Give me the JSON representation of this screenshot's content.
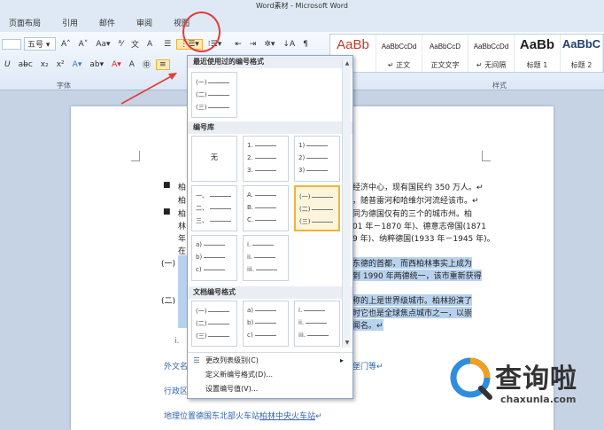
{
  "window": {
    "title": "Word素材 - Microsoft Word"
  },
  "tabs": [
    "页面布局",
    "引用",
    "邮件",
    "审阅",
    "视图"
  ],
  "ribbon": {
    "font_size": "五号",
    "font_group_label": "字体",
    "styles_group_label": "样式",
    "styles": [
      {
        "preview": "AaBb",
        "label": ""
      },
      {
        "preview": "AaBbCcDd",
        "label": "↵ 正文"
      },
      {
        "preview": "AaBbCcD",
        "label": "正文文字"
      },
      {
        "preview": "AaBbCcDd",
        "label": "↵ 无间隔"
      },
      {
        "preview": "AaBb",
        "label": "标题 1"
      },
      {
        "preview": "AaBbC",
        "label": "标题 2"
      }
    ]
  },
  "dropdown": {
    "recent_header": "最近使用过的编号格式",
    "library_header": "编号库",
    "doc_header": "文档编号格式",
    "none_label": "无",
    "recent": [
      [
        "(一)",
        "(二)",
        "(三)"
      ]
    ],
    "library": [
      [
        "1.",
        "2.",
        "3."
      ],
      [
        "1)",
        "2)",
        "3)"
      ],
      [
        "一、",
        "二、",
        "三、"
      ],
      [
        "A.",
        "B.",
        "C."
      ],
      [
        "(一)",
        "(二)",
        "(三)"
      ],
      [
        "a)",
        "b)",
        "c)"
      ],
      [
        "i.",
        "ii.",
        "iii."
      ]
    ],
    "document": [
      [
        "(一)",
        "(二)",
        "(三)"
      ],
      [
        "a)",
        "b)",
        "c)"
      ],
      [
        "i.",
        "ii.",
        "iii."
      ]
    ],
    "menu": [
      {
        "icon": "☰",
        "label": "更改列表级别(C)"
      },
      {
        "icon": "",
        "label": "定义新编号格式(D)..."
      },
      {
        "icon": "",
        "label": "设置编号值(V)..."
      }
    ]
  },
  "document": {
    "lines": [
      "经济中心，现有国民约 350 万人。↵",
      "，随普雷河和哈维尔河流经该市。↵",
      "同为德国仅有的三个的城市州。柏",
      "01 年－1870 年)、德意志帝国(1871",
      "9 年)、纳粹德国(1933 年－1945 年)。"
    ],
    "left_snips": [
      "柏",
      "柏",
      "柏",
      "林",
      "年",
      "在"
    ],
    "hl_lines": [
      "东德的首都，而西柏林事实上成为",
      "到 1990 年两德统一，该市重新获得",
      "称的上是世界级城市。柏林扮演了",
      "时它也是全球焦点城市之一，以崇",
      "闻名。↵"
    ],
    "heading1": "(一)",
    "heading2": "(二)",
    "item_i": "i.",
    "foreign_name": "外文名",
    "admin": "行政区",
    "gate": "堡门等↵",
    "location_prefix": "地理位置德国东北部火车站",
    "location_link": "柏林中央火车站",
    "location_end": "↵"
  },
  "watermark": {
    "text": "查询啦",
    "sub": "chaxunla.com"
  }
}
